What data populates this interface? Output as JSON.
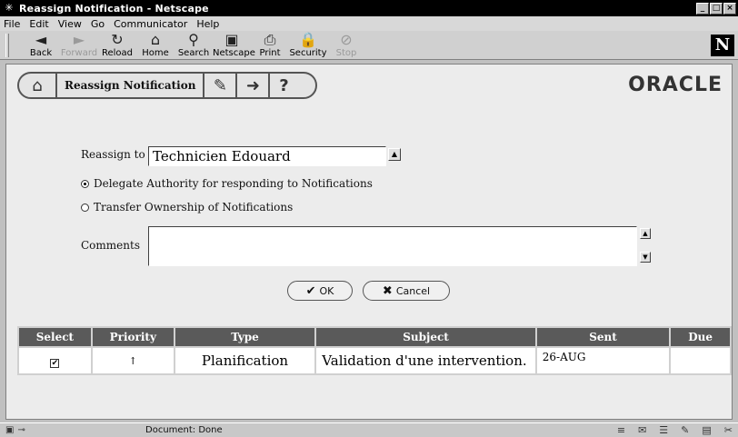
{
  "window": {
    "title": "Reassign Notification - Netscape",
    "controls": [
      "_",
      "□",
      "×"
    ]
  },
  "menu": [
    "File",
    "Edit",
    "View",
    "Go",
    "Communicator",
    "Help"
  ],
  "toolbar": {
    "buttons": [
      {
        "label": "Back",
        "icon": "back-arrow-icon",
        "glyph": "◄",
        "enabled": true
      },
      {
        "label": "Forward",
        "icon": "forward-arrow-icon",
        "glyph": "►",
        "enabled": false
      },
      {
        "label": "Reload",
        "icon": "reload-icon",
        "glyph": "↻",
        "enabled": true
      },
      {
        "label": "Home",
        "icon": "home-icon",
        "glyph": "⌂",
        "enabled": true
      },
      {
        "label": "Search",
        "icon": "search-icon",
        "glyph": "⚲",
        "enabled": true
      },
      {
        "label": "Netscape",
        "icon": "netscape-icon",
        "glyph": "▣",
        "enabled": true
      },
      {
        "label": "Print",
        "icon": "print-icon",
        "glyph": "⎙",
        "enabled": true
      },
      {
        "label": "Security",
        "icon": "security-icon",
        "glyph": "🔒",
        "enabled": true
      },
      {
        "label": "Stop",
        "icon": "stop-icon",
        "glyph": "⊘",
        "enabled": false
      }
    ],
    "logo_letter": "N"
  },
  "header": {
    "title": "Reassign Notification",
    "brand": "ORACLE",
    "home_icon": "⌂",
    "tag_icon": "✎",
    "exit_icon": "➜",
    "help_icon": "?"
  },
  "form": {
    "reassign_label": "Reassign to",
    "reassign_value": "Technicien Edouard",
    "option_delegate": "Delegate Authority for responding to Notifications",
    "option_transfer": "Transfer Ownership of Notifications",
    "selected_option": "delegate",
    "comments_label": "Comments",
    "comments_value": "",
    "ok_label": "OK",
    "cancel_label": "Cancel"
  },
  "table": {
    "headers": [
      "Select",
      "Priority",
      "Type",
      "Subject",
      "Sent",
      "Due"
    ],
    "rows": [
      {
        "select": "☑",
        "priority": "↑",
        "type": "Planification",
        "subject": "Validation d'une intervention.",
        "sent": "26-AUG",
        "due": ""
      }
    ]
  },
  "status": {
    "text": "Document: Done"
  }
}
